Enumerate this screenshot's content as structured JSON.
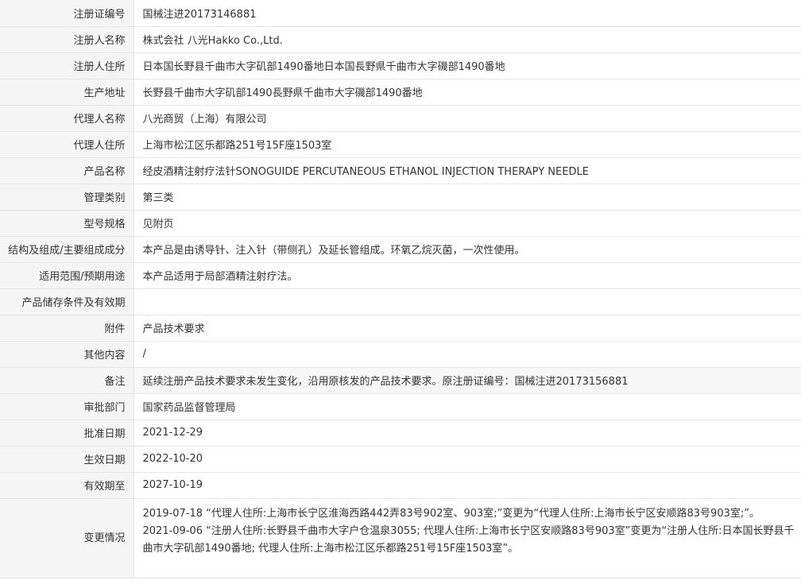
{
  "rows": [
    {
      "label": "注册证编号",
      "value": "国械注进20173146881"
    },
    {
      "label": "注册人名称",
      "value": "株式会社 八光Hakko Co.,Ltd."
    },
    {
      "label": "注册人住所",
      "value": "日本国长野县千曲市大字矶部1490番地日本国長野県千曲市大字磯部1490番地"
    },
    {
      "label": "生产地址",
      "value": "长野县千曲市大字矶部1490長野県千曲市大字磯部1490番地"
    },
    {
      "label": "代理人名称",
      "value": "八光商贸（上海）有限公司"
    },
    {
      "label": "代理人住所",
      "value": "上海市松江区乐都路251号15F座1503室"
    },
    {
      "label": "产品名称",
      "value": "经皮酒精注射疗法针SONOGUIDE PERCUTANEOUS ETHANOL INJECTION THERAPY NEEDLE"
    },
    {
      "label": "管理类别",
      "value": "第三类"
    },
    {
      "label": "型号规格",
      "value": "见附页"
    },
    {
      "label": "结构及组成/主要组成成分",
      "value": "本产品是由诱导针、注入针（带侧孔）及延长管组成。环氧乙烷灭菌，一次性使用。"
    },
    {
      "label": "适用范围/预期用途",
      "value": "本产品适用于局部酒精注射疗法。"
    },
    {
      "label": "产品储存条件及有效期",
      "value": ""
    },
    {
      "label": "附件",
      "value": "产品技术要求"
    },
    {
      "label": "其他内容",
      "value": "/"
    },
    {
      "label": "备注",
      "value": "延续注册产品技术要求未发生变化，沿用原核发的产品技术要求。原注册证编号：国械注进20173156881"
    },
    {
      "label": "审批部门",
      "value": "国家药品监督管理局"
    },
    {
      "label": "批准日期",
      "value": "2021-12-29"
    },
    {
      "label": "生效日期",
      "value": "2022-10-20"
    },
    {
      "label": "有效期至",
      "value": "2027-10-19"
    }
  ],
  "changes": {
    "label": "变更情况",
    "items": [
      "2019-07-18 “代理人住所:上海市长宁区淮海西路442弄83号902室、903室;”变更为“代理人住所:上海市长宁区安顺路83号903室;”。",
      "2021-09-06 “注册人住所:长野县千曲市大字户仓温泉3055; 代理人住所:上海市长宁区安顺路83号903室”变更为“注册人住所:日本国长野县千曲市大字矶部1490番地; 代理人住所:上海市松江区乐都路251号15F座1503室”。"
    ]
  }
}
